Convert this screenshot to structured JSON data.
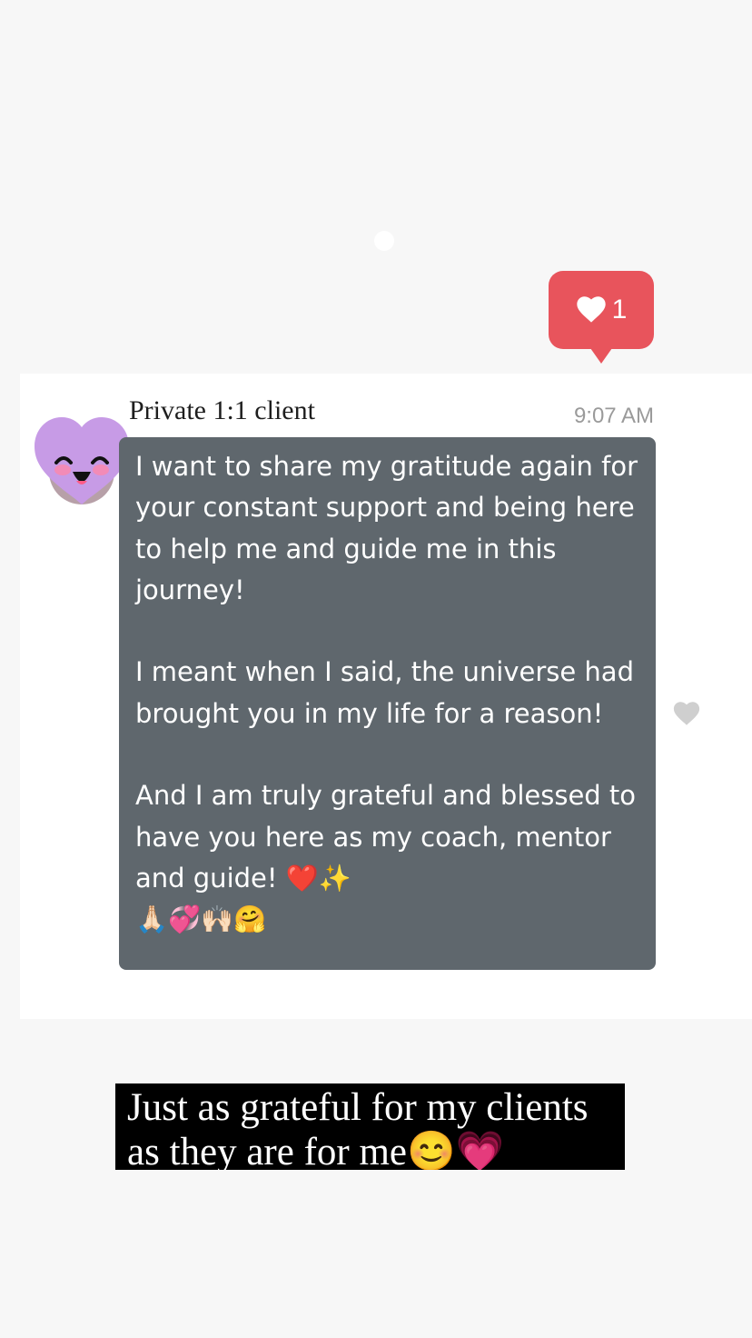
{
  "story": {
    "like_badge": {
      "icon": "heart-icon",
      "count": "1",
      "color": "#e8545c"
    },
    "message": {
      "avatar_icon": "purple-heart-smiley-avatar-icon",
      "sender": "Private 1:1 client",
      "time": "9:07 AM",
      "text": "I want to share my gratitude again for your constant support and being here to help me and guide me in this journey!\n\nI meant when I said, the universe had brought you in my life for a reason!\n\nAnd I am truly grateful and blessed to have you here as my coach, mentor and guide! ❤️✨\n🙏🏻💞🙌🏻🤗",
      "bubble_color": "#5f676d",
      "reaction_icon": "heart-outline-icon"
    },
    "caption": "Just as grateful for my clients\nas they are for me😊💗"
  }
}
